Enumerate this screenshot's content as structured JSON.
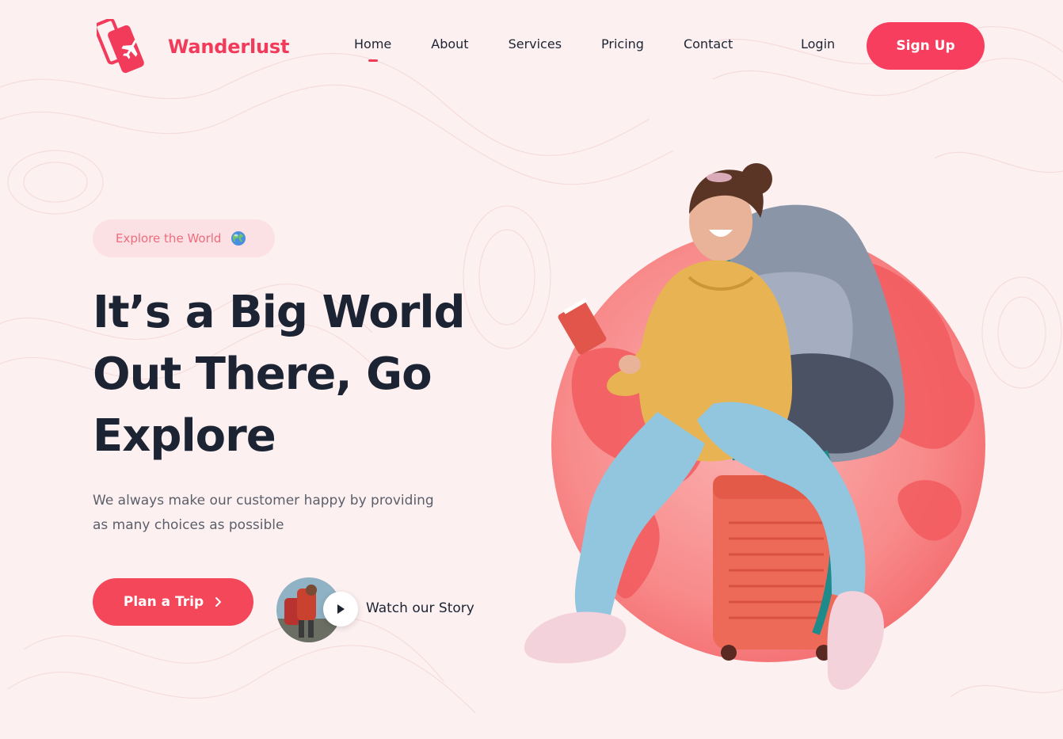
{
  "brand": {
    "name": "Wanderlust",
    "accent": "#f23a5a",
    "logo_icon": "ticket-plane-icon"
  },
  "nav": {
    "items": [
      {
        "label": "Home",
        "active": true
      },
      {
        "label": "About",
        "active": false
      },
      {
        "label": "Services",
        "active": false
      },
      {
        "label": "Pricing",
        "active": false
      },
      {
        "label": "Contact",
        "active": false
      }
    ],
    "login_label": "Login",
    "signup_label": "Sign Up"
  },
  "hero": {
    "badge_text": "Explore the World",
    "badge_icon": "globe-icon",
    "title_lines": [
      "It’s a Big World",
      "Out There, Go",
      "Explore"
    ],
    "subtitle_lines": [
      "We always make our customer happy by providing",
      "as many choices as possible"
    ],
    "primary_cta": "Plan a Trip",
    "primary_cta_icon": "chevron-right-icon",
    "video_cta": "Watch our Story",
    "video_icon": "play-icon"
  },
  "colors": {
    "background": "#fdf0f0",
    "primary_button": "#f44759",
    "heading": "#1c2433",
    "body_text": "#5b5f6a",
    "globe": "#f87b80"
  }
}
